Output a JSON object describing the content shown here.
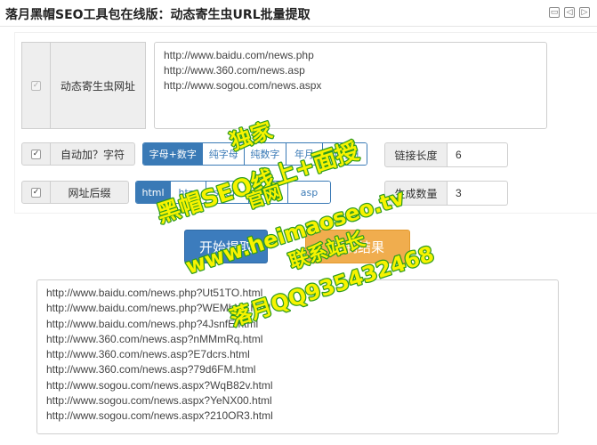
{
  "app": {
    "title": "落月黑帽SEO工具包在线版：动态寄生虫URL批量提取"
  },
  "toolbar_icons": [
    "print-icon",
    "back-icon",
    "forward-icon"
  ],
  "form": {
    "url_label": "动态寄生虫网址",
    "url_input_lines": [
      "http://www.baidu.com/news.php",
      "http://www.360.com/news.asp",
      "http://www.sogou.com/news.aspx"
    ],
    "auto_label": "自动加？字符",
    "auto_checked": true,
    "mode_options": [
      "字母+数字",
      "纯字母",
      "纯数字",
      "年月",
      "年月日"
    ],
    "mode_selected": "字母+数字",
    "suffix_label": "网址后缀",
    "suffix_checked": true,
    "suffix_options": [
      "html",
      "htm",
      "shtml",
      "xml",
      "asp"
    ],
    "suffix_selected": "html",
    "link_length_label": "链接长度",
    "link_length_value": "6",
    "count_label": "生成数量",
    "count_value": "3"
  },
  "buttons": {
    "start_label": "开始提取",
    "copy_label": "复制结果"
  },
  "results": [
    "http://www.baidu.com/news.php?Ut51TO.html",
    "http://www.baidu.com/news.php?WEMbX8.html",
    "http://www.baidu.com/news.php?4JsnfE.html",
    "http://www.360.com/news.asp?nMMmRq.html",
    "http://www.360.com/news.asp?E7dcrs.html",
    "http://www.360.com/news.asp?79d6FM.html",
    "http://www.sogou.com/news.aspx?WqB82v.html",
    "http://www.sogou.com/news.aspx?YeNX00.html",
    "http://www.sogou.com/news.aspx?210OR3.html"
  ],
  "watermark": {
    "lines": [
      "独家",
      "黑帽SEO线上+面授",
      "官网",
      "www.heimaoseo.tv",
      "联系站长",
      "落月QQ935432468"
    ],
    "color_dark": "#1a1a1a",
    "color_text": "#f7f300",
    "color_stroke": "#2e9b1e"
  }
}
